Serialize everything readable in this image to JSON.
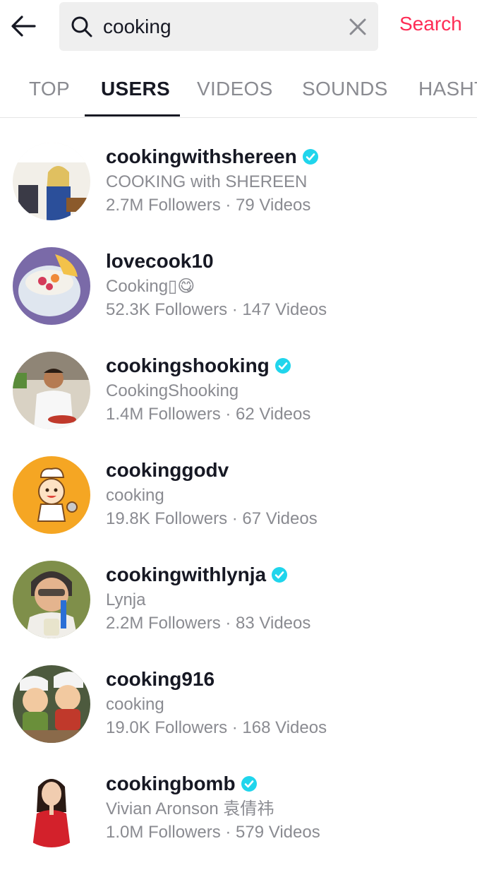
{
  "search": {
    "query": "cooking",
    "button_label": "Search"
  },
  "tabs": [
    {
      "label": "TOP"
    },
    {
      "label": "USERS"
    },
    {
      "label": "VIDEOS"
    },
    {
      "label": "SOUNDS"
    },
    {
      "label": "HASHT"
    }
  ],
  "colors": {
    "accent": "#fe2c55",
    "verified": "#20d5ec",
    "muted": "#8a8b91"
  },
  "icons": {
    "back": "arrow-left-icon",
    "search": "search-icon",
    "clear": "close-icon",
    "verified": "verified-badge-icon"
  },
  "users": [
    {
      "username": "cookingwithshereen",
      "verified": true,
      "nickname": "COOKING with SHEREEN",
      "stats": "2.7M Followers · 79 Videos"
    },
    {
      "username": "lovecook10",
      "verified": false,
      "nickname": "Cooking▯😋",
      "stats": "52.3K Followers · 147 Videos"
    },
    {
      "username": "cookingshooking",
      "verified": true,
      "nickname": "CookingShooking",
      "stats": "1.4M Followers · 62 Videos"
    },
    {
      "username": "cookinggodv",
      "verified": false,
      "nickname": "cooking",
      "stats": "19.8K Followers · 67 Videos"
    },
    {
      "username": "cookingwithlynja",
      "verified": true,
      "nickname": "Lynja",
      "stats": "2.2M Followers · 83 Videos"
    },
    {
      "username": "cooking916",
      "verified": false,
      "nickname": "cooking",
      "stats": "19.0K Followers · 168 Videos"
    },
    {
      "username": "cookingbomb",
      "verified": true,
      "nickname": "Vivian Aronson 袁倩祎",
      "stats": "1.0M Followers · 579 Videos"
    }
  ]
}
